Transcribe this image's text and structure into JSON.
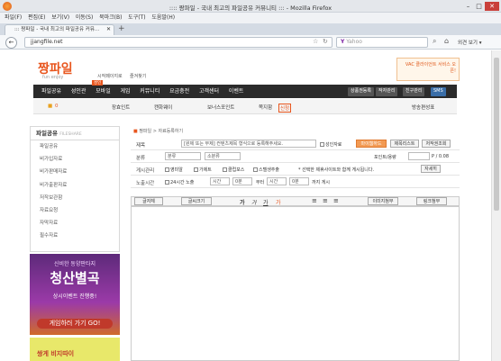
{
  "window": {
    "title": ":::: 짱파일 - 국내 최고의 파일공유 커뮤니티 ::: - Mozilla Firefox"
  },
  "menu": [
    "파일(F)",
    "편집(E)",
    "보기(V)",
    "이동(S)",
    "북마크(B)",
    "도구(T)",
    "도움말(H)"
  ],
  "tab": {
    "label": "::: 짱파일 - 국내 최고의 파일공유 커뮤...",
    "new": "+"
  },
  "nav": {
    "url": "jjangfile.net",
    "search_placeholder": "Yahoo",
    "star": "☆"
  },
  "site": {
    "logo": "짱파일",
    "logo_sub": "fun enjoy",
    "top_links": [
      "시작페이지로",
      "즐겨찾기"
    ],
    "ad_text": "VAC 클라이언트 서비스 오픈!",
    "nav_items": [
      "파일공유",
      "성인관",
      "모바일",
      "게임",
      "커뮤니티",
      "요금충전",
      "고객센터",
      "이벤트"
    ],
    "nav_badge": "성인",
    "nav_buttons": [
      "상품권등록",
      "작자관리",
      "친구관리",
      "SMS"
    ],
    "sub": {
      "point0": "0",
      "coupon": "장효인트",
      "cash": "캔화웨이",
      "bonus": "보너스포인트",
      "mail": "쪽지함",
      "mail_badge": "신청",
      "mode": "방송편성표"
    }
  },
  "sidebar": {
    "title": "파일공유",
    "title_sub": "FILESHARE",
    "items": [
      "파일공유",
      "비가입자료",
      "비가판매자료",
      "비가출판자료",
      "저작보관함",
      "자료요청",
      "자막자료",
      "필수자료"
    ]
  },
  "banner": {
    "line1": "신비한 동양판타지",
    "line2": "청산별곡",
    "line3": "상시이벤트 진행중!",
    "line4": "게임하러 가기 GO!",
    "bottom": "쌍게 비지따이"
  },
  "form": {
    "breadcrumb": "짱파일 > 자료등록하기",
    "title_label": "제목",
    "title_placeholder": "[원제 또는 부제] 컨텐츠제목 형식으로 등록해주세요.",
    "adult_label": "성인자료",
    "btn_myweb": "마이웹하드",
    "btn_temp": "제목리스트",
    "btn_dup": "저작권조회",
    "category_label": "분류",
    "category_sel1": "분류",
    "category_sel2": "소분류",
    "point_label": "포인트/용량",
    "point_unit": "P / 0.08",
    "posting_label": "게시관리",
    "opt1": "영미알",
    "opt2": "가제트",
    "opt3": "클럽포스",
    "opt4": "스텔생추출",
    "posting_note": "* 선택한 제휴사이트와 함께 게시됩니다.",
    "btn_detail": "자세히",
    "time_label": "노출시간",
    "time_opt": "24시간 노출",
    "time_sel1": "시간",
    "time_sel2": "0분",
    "time_mid": "부터",
    "time_sel3": "시간",
    "time_sel4": "0분",
    "time_end": "까지 게시",
    "tb_font": "글자체",
    "tb_size": "글씨크기",
    "tb_img": "이미지첨부",
    "tb_link": "링크첨부"
  },
  "colors": {
    "accent": "#e8561e",
    "topbar": "#2b2b2b"
  }
}
